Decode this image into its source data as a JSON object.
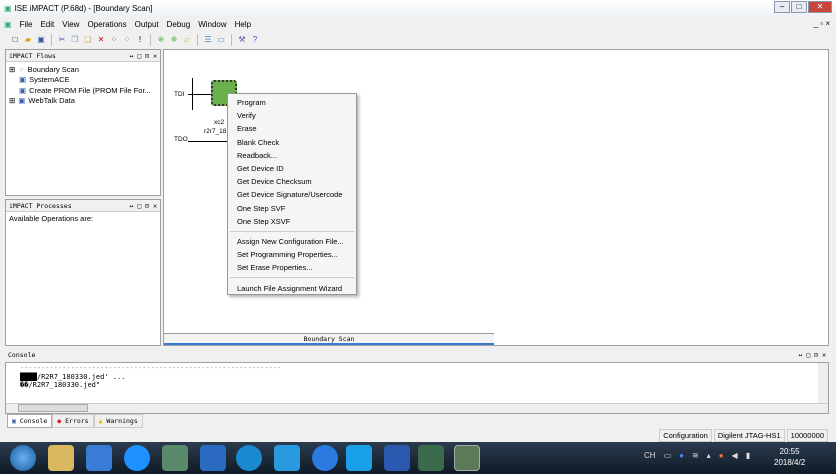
{
  "window": {
    "title": "ISE iMPACT (P.68d) - [Boundary Scan]"
  },
  "menu": [
    "File",
    "Edit",
    "View",
    "Operations",
    "Output",
    "Debug",
    "Window",
    "Help"
  ],
  "flows": {
    "title": "iMPACT Flows",
    "items": [
      "Boundary Scan",
      "SystemACE",
      "Create PROM File (PROM File For...",
      "WebTalk Data"
    ]
  },
  "processes": {
    "title": "iMPACT Processes",
    "text": "Available Operations are:"
  },
  "canvas": {
    "tdi": "TDI",
    "tdo": "TDO",
    "device_name": "xc2",
    "device_file": "r2r7_18",
    "tab": "Boundary Scan"
  },
  "context_menu": {
    "group1": [
      "Program",
      "Verify",
      "Erase",
      "Blank Check",
      "Readback...",
      "Get Device ID",
      "Get Device Checksum",
      "Get Device Signature/Usercode",
      "One Step SVF",
      "One Step XSVF"
    ],
    "group2": [
      "Assign New Configuration File...",
      "Set Programming Properties...",
      "Set Erase Properties..."
    ],
    "group3": [
      "Launch File Assignment Wizard"
    ]
  },
  "console": {
    "title": "Console",
    "rule": "--------------------------------------------------------------",
    "lines": [
      "/R2R7_180330.jed' ...",
      "\u0000\u0000/R2R7_180330.jed\""
    ],
    "highlight": "████",
    "line2_prefix": "��",
    "line2": "/R2R7_180330.jed\"",
    "tabs": [
      "Console",
      "Errors",
      "Warnings"
    ]
  },
  "status": [
    "Configuration",
    "Digilent JTAG-HS1",
    "10000000"
  ],
  "clock": {
    "time": "20:55",
    "date": "2018/4/2"
  },
  "tray": {
    "ime": "CH"
  }
}
